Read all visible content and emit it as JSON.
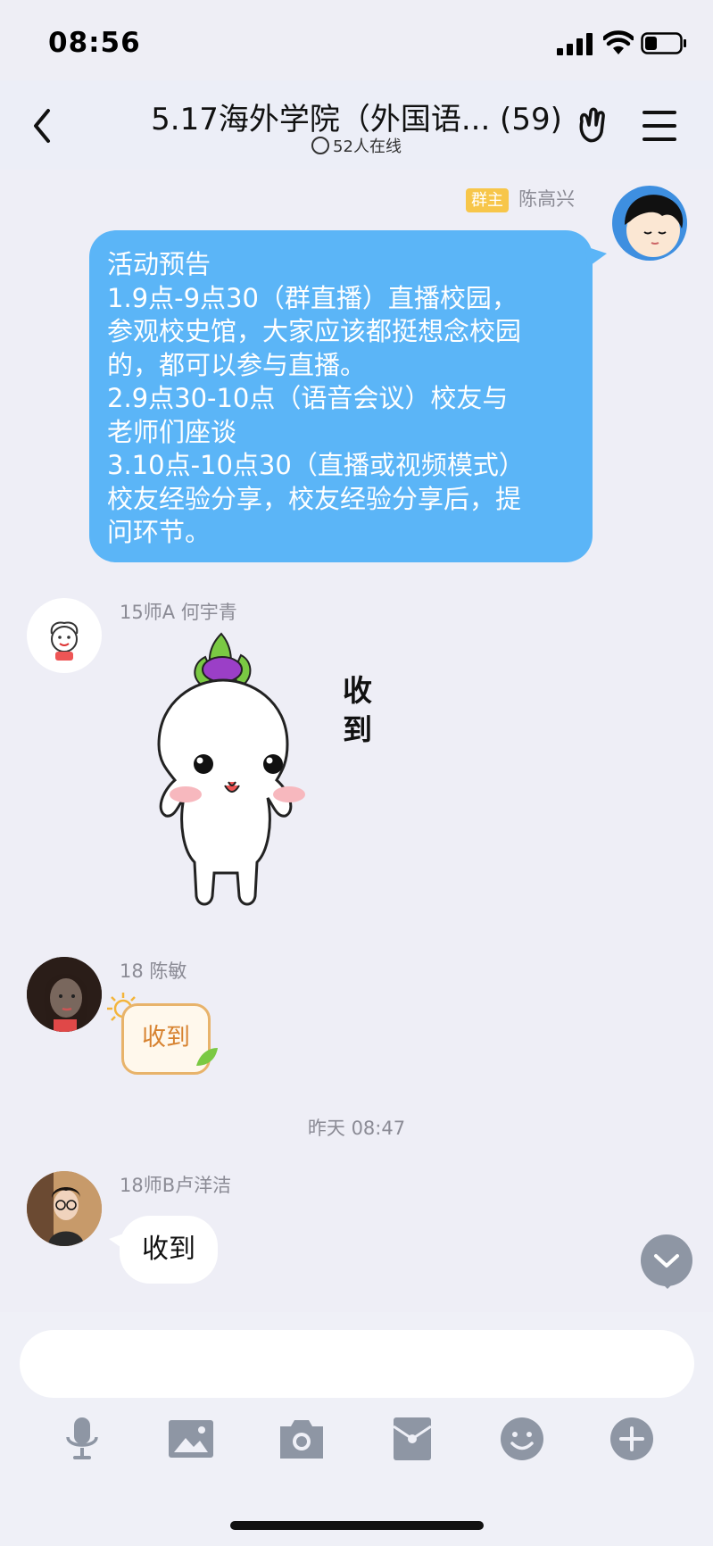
{
  "status_bar": {
    "time": "08:56"
  },
  "header": {
    "title": "5.17海外学院（外国语... (59)",
    "online_status": "52人在线"
  },
  "messages": [
    {
      "badge": "群主",
      "sender": "陈高兴",
      "lines": [
        "活动预告",
        "1.9点-9点30（群直播）直播校园，",
        "参观校史馆，大家应该都挺想念校园",
        "的，都可以参与直播。",
        "2.9点30-10点（语音会议）校友与",
        "老师们座谈",
        "3.10点-10点30（直播或视频模式）",
        "校友经验分享，校友经验分享后，提",
        "问环节。"
      ]
    },
    {
      "sender": "15师A 何宇青",
      "sticker_text": "收到"
    },
    {
      "sender": "18 陈敏",
      "sticker_text": "收到"
    },
    {
      "timestamp": "昨天 08:47"
    },
    {
      "sender": "18师B卢洋洁",
      "text": "收到"
    }
  ],
  "colors": {
    "bubble_blue": "#5bb5f7",
    "owner_badge": "#f7c64a",
    "background": "#eeeef6",
    "icon_gray": "#8e96a4"
  },
  "toolbar": {
    "icons": [
      "microphone-icon",
      "image-icon",
      "camera-icon",
      "red-packet-icon",
      "emoji-icon",
      "plus-icon"
    ]
  }
}
